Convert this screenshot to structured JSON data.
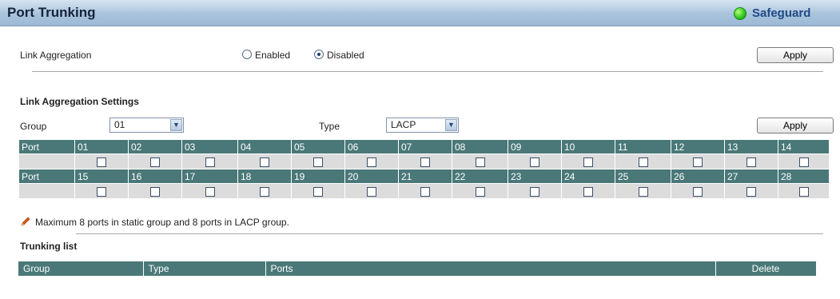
{
  "header": {
    "title": "Port Trunking",
    "safeguard_label": "Safeguard"
  },
  "link_aggregation": {
    "label": "Link Aggregation",
    "options": [
      "Enabled",
      "Disabled"
    ],
    "selected": "Disabled",
    "apply_label": "Apply"
  },
  "settings": {
    "heading": "Link Aggregation Settings",
    "group_label": "Group",
    "group_value": "01",
    "type_label": "Type",
    "type_value": "LACP",
    "apply_label": "Apply"
  },
  "ports_table": {
    "row_label": "Port",
    "rows": [
      [
        "01",
        "02",
        "03",
        "04",
        "05",
        "06",
        "07",
        "08",
        "09",
        "10",
        "11",
        "12",
        "13",
        "14"
      ],
      [
        "15",
        "16",
        "17",
        "18",
        "19",
        "20",
        "21",
        "22",
        "23",
        "24",
        "25",
        "26",
        "27",
        "28"
      ]
    ]
  },
  "note": "Maximum 8 ports in static group and 8 ports in LACP group.",
  "trunking_list": {
    "heading": "Trunking list",
    "columns": [
      "Group",
      "Type",
      "Ports",
      "Delete"
    ]
  },
  "colors": {
    "table_header": "#4a7878",
    "title_bar": "#a9c3dc",
    "safeguard": "#214a86"
  }
}
